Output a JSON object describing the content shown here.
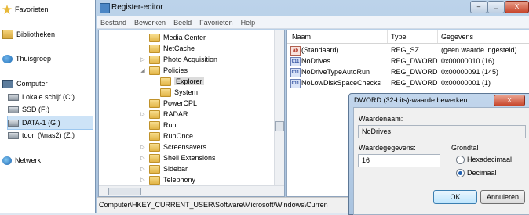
{
  "nav": {
    "favorites": "Favorieten",
    "libraries": "Bibliotheken",
    "homegroup": "Thuisgroep",
    "computer": "Computer",
    "drives": [
      {
        "label": "Lokale schijf (C:)"
      },
      {
        "label": "SSD (F:)"
      },
      {
        "label": "DATA-1 (G:)"
      },
      {
        "label": "toon (\\\\nas2) (Z:)"
      }
    ],
    "network": "Netwerk"
  },
  "window": {
    "title": "Register-editor",
    "controls": {
      "minimize": "–",
      "maximize": "□",
      "close": "X"
    }
  },
  "menu": [
    "Bestand",
    "Bewerken",
    "Beeld",
    "Favorieten",
    "Help"
  ],
  "tree": [
    {
      "label": "Media Center",
      "expander": ""
    },
    {
      "label": "NetCache",
      "expander": ""
    },
    {
      "label": "Photo Acquisition",
      "expander": "▷"
    },
    {
      "label": "Policies",
      "expander": "◢"
    },
    {
      "label": "Explorer",
      "expander": ""
    },
    {
      "label": "System",
      "expander": ""
    },
    {
      "label": "PowerCPL",
      "expander": ""
    },
    {
      "label": "RADAR",
      "expander": "▷"
    },
    {
      "label": "Run",
      "expander": ""
    },
    {
      "label": "RunOnce",
      "expander": ""
    },
    {
      "label": "Screensavers",
      "expander": "▷"
    },
    {
      "label": "Shell Extensions",
      "expander": "▷"
    },
    {
      "label": "Sidebar",
      "expander": "▷"
    },
    {
      "label": "Telephony",
      "expander": "▷"
    }
  ],
  "list": {
    "headers": {
      "name": "Naam",
      "type": "Type",
      "data": "Gegevens"
    },
    "rows": [
      {
        "icon": "ab",
        "name": "(Standaard)",
        "type": "REG_SZ",
        "data": "(geen waarde ingesteld)"
      },
      {
        "icon": "011",
        "name": "NoDrives",
        "type": "REG_DWORD",
        "data": "0x00000010 (16)"
      },
      {
        "icon": "011",
        "name": "NoDriveTypeAutoRun",
        "type": "REG_DWORD",
        "data": "0x00000091 (145)"
      },
      {
        "icon": "011",
        "name": "NoLowDiskSpaceChecks",
        "type": "REG_DWORD",
        "data": "0x00000001 (1)"
      }
    ]
  },
  "status": "Computer\\HKEY_CURRENT_USER\\Software\\Microsoft\\Windows\\Curren",
  "dialog": {
    "title": "DWORD (32-bits)-waarde bewerken",
    "close": "X",
    "value_name_label": "Waardenaam:",
    "value_name": "NoDrives",
    "value_data_label": "Waardegegevens:",
    "value_data": "16",
    "base_label": "Grondtal",
    "hex_label": "Hexadecimaal",
    "dec_label": "Decimaal",
    "selected_base": "Decimaal",
    "ok": "OK",
    "cancel": "Annuleren"
  }
}
